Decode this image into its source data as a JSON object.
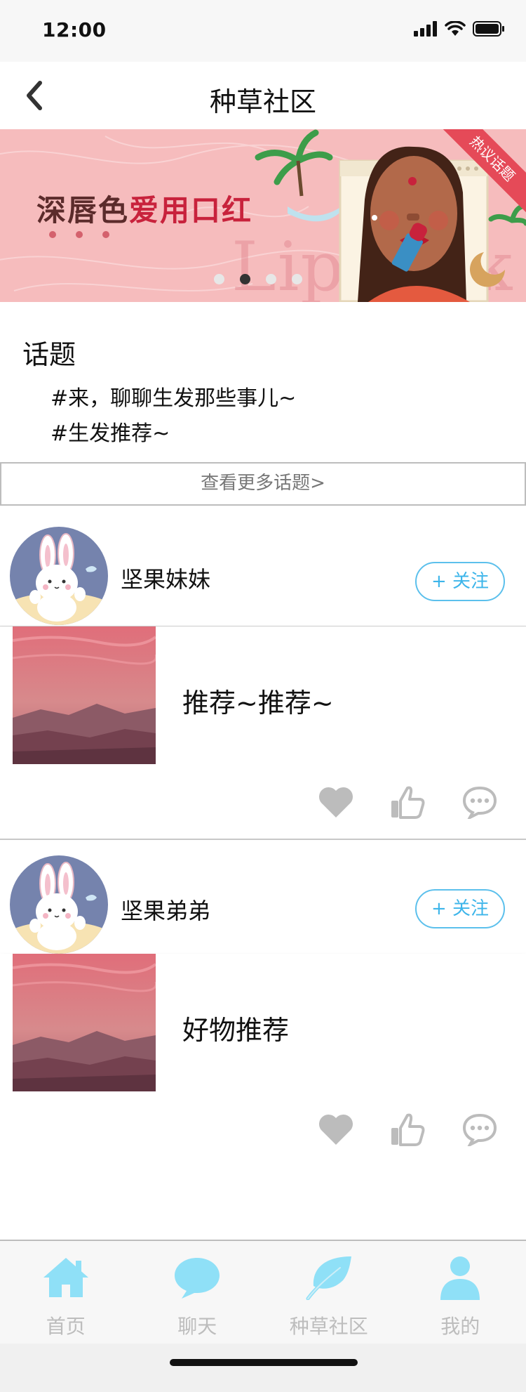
{
  "status": {
    "time": "12:00"
  },
  "nav": {
    "title": "种草社区"
  },
  "banner": {
    "title_part1": "深唇色",
    "title_part2": "爱用口红",
    "watermark": "Lipstick",
    "ribbon": "热议话题",
    "slide_count": 4,
    "active_slide": 1
  },
  "topics": {
    "heading": "话题",
    "items": [
      "#来，聊聊生发那些事儿~",
      "#生发推荐~"
    ],
    "more": "查看更多话题>"
  },
  "posts": [
    {
      "username": "坚果妹妹",
      "follow": "+ 关注",
      "title": "推荐~推荐~"
    },
    {
      "username": "坚果弟弟",
      "follow": "+ 关注",
      "title": "好物推荐"
    }
  ],
  "tabs": [
    {
      "label": "首页",
      "icon": "home-icon"
    },
    {
      "label": "聊天",
      "icon": "chat-bubble-icon"
    },
    {
      "label": "种草社区",
      "icon": "leaf-icon"
    },
    {
      "label": "我的",
      "icon": "user-icon"
    }
  ],
  "colors": {
    "accent": "#3db5ea",
    "tab_icon": "#8fe0f7",
    "banner_bg": "#f6bcbd",
    "action_icon": "#bcbcbc"
  }
}
